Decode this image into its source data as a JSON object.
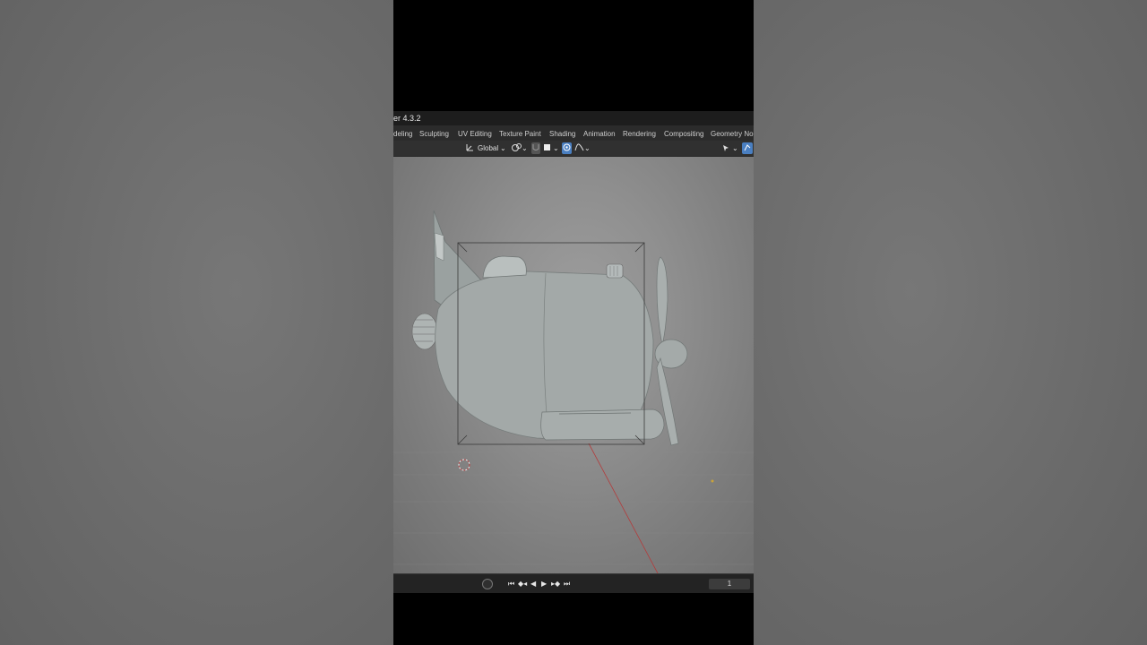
{
  "app": {
    "title": "er 4.3.2"
  },
  "workspace_tabs": [
    "deling",
    "Sculpting",
    "UV Editing",
    "Texture Paint",
    "Shading",
    "Animation",
    "Rendering",
    "Compositing",
    "Geometry Nod"
  ],
  "header": {
    "transform_orientation": "Global"
  },
  "timeline": {
    "current_frame": "1",
    "playback_icons": [
      "jump-start-icon",
      "prev-keyframe-icon",
      "play-reverse-icon",
      "play-icon",
      "next-keyframe-icon",
      "jump-end-icon"
    ]
  },
  "colors": {
    "viewport_bg": "#8f8f8f",
    "header_bg": "#303030",
    "accent_blue": "#4a7fc1",
    "x_axis_red": "#b33b3b"
  }
}
